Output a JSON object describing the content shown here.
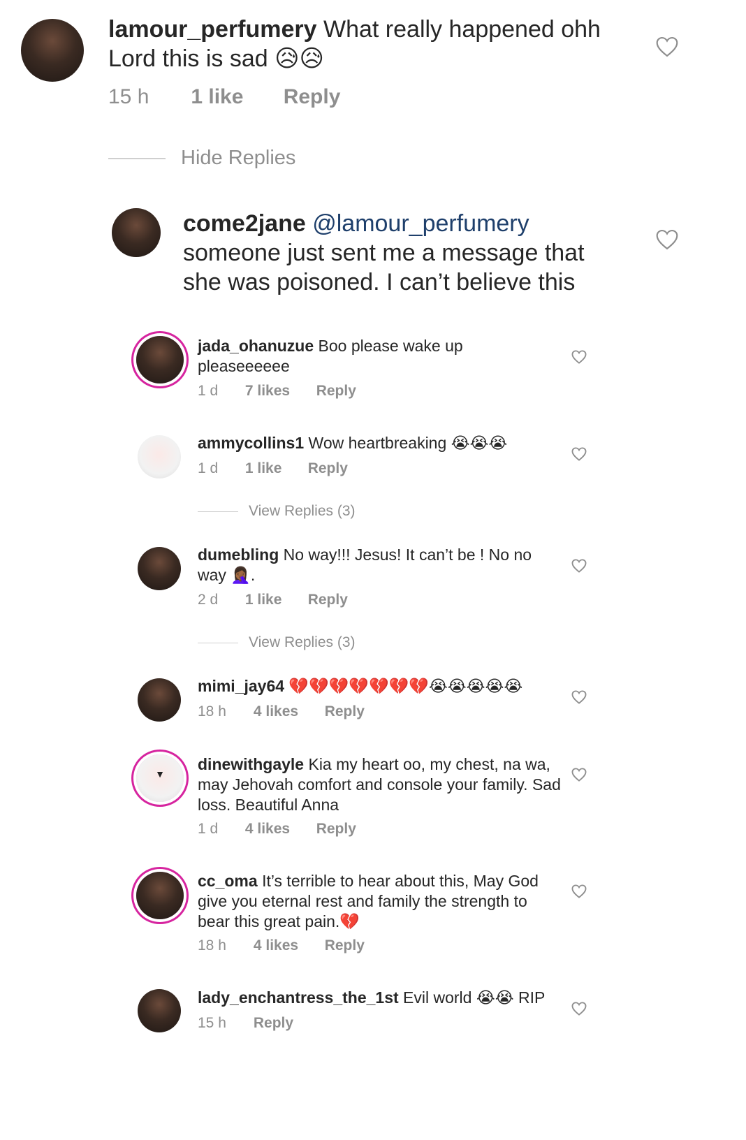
{
  "comments": [
    {
      "username": "lamour_perfumery",
      "text": "What really happened ohh Lord this is sad 😥😥",
      "time": "15 h",
      "likes": "1 like",
      "reply": "Reply"
    }
  ],
  "hide_replies": "Hide Replies",
  "reply_main": {
    "username": "come2jane",
    "mention": "@lamour_perfumery",
    "text": "someone just sent me a message that she was poisoned. I can’t believe this"
  },
  "replies": [
    {
      "username": "jada_ohanuzue",
      "text": "Boo please wake up pleaseeeeee",
      "time": "1 d",
      "likes": "7 likes",
      "reply": "Reply"
    },
    {
      "username": "ammycollins1",
      "text": "Wow heartbreaking 😭😭😭",
      "time": "1 d",
      "likes": "1 like",
      "reply": "Reply",
      "view_replies": "View Replies (3)"
    },
    {
      "username": "dumebling",
      "text": "No way!!! Jesus! It can’t be ! No no way 🤦🏾‍♀️.",
      "time": "2 d",
      "likes": "1 like",
      "reply": "Reply",
      "view_replies": "View Replies (3)"
    },
    {
      "username": "mimi_jay64",
      "text": "💔💔💔💔💔💔💔😭😭😭😭😭",
      "time": "18 h",
      "likes": "4 likes",
      "reply": "Reply"
    },
    {
      "username": "dinewithgayle",
      "text": "Kia my heart oo, my chest, na wa, may Jehovah comfort and console your family. Sad loss. Beautiful Anna",
      "time": "1 d",
      "likes": "4 likes",
      "reply": "Reply"
    },
    {
      "username": "cc_oma",
      "text": "It’s terrible to hear about this, May God give you eternal rest and family the strength to bear this great pain.💔",
      "time": "18 h",
      "likes": "4 likes",
      "reply": "Reply"
    },
    {
      "username": "lady_enchantress_the_1st",
      "text": "Evil world 😭😭 RIP",
      "time": "15 h",
      "reply": "Reply"
    }
  ],
  "icons": {
    "like": "heart-outline-icon"
  },
  "colors": {
    "username": "#262626",
    "meta": "#8e8e8e",
    "mention": "#1e3f6b",
    "story_ring": "#d6249f"
  }
}
